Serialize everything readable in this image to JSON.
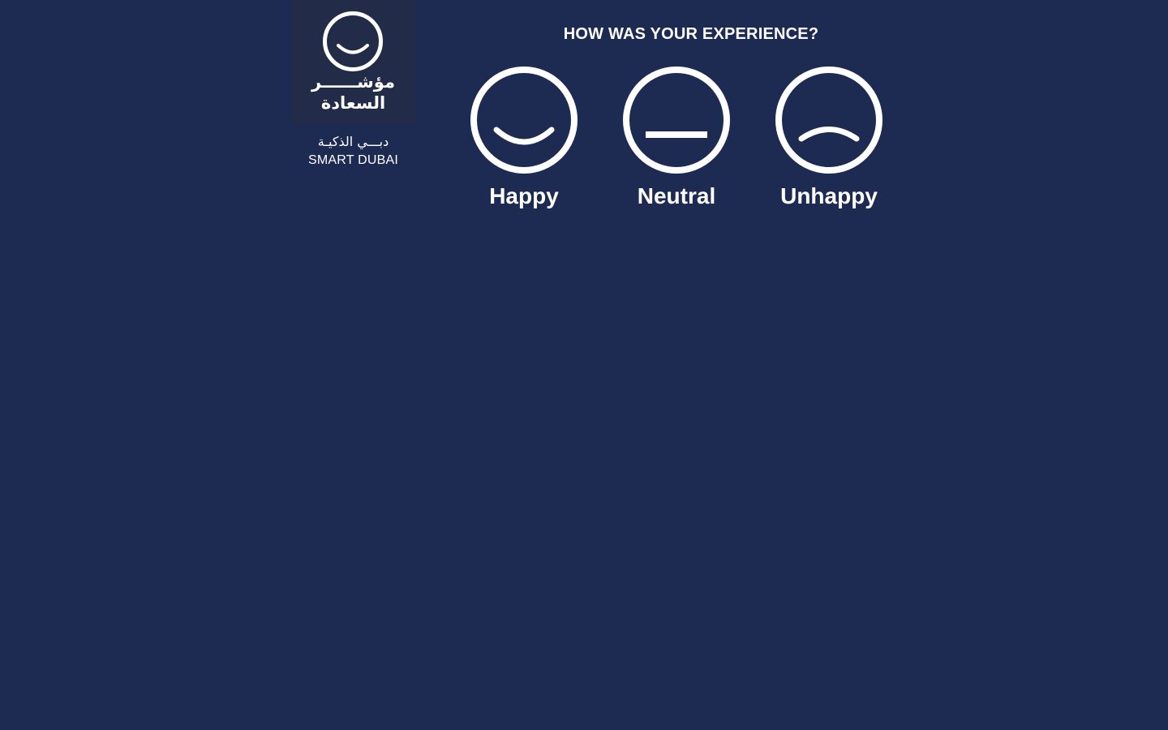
{
  "logo": {
    "arabic_line1": "مؤشــــــر",
    "arabic_line2": "السعادة",
    "icon": "smiley-face-icon"
  },
  "brand": {
    "arabic": "دبـــي الذكيـة",
    "english": "SMART DUBAI"
  },
  "survey": {
    "question": "HOW WAS YOUR EXPERIENCE?",
    "options": [
      {
        "label": "Happy",
        "icon": "happy-face-icon"
      },
      {
        "label": "Neutral",
        "icon": "neutral-face-icon"
      },
      {
        "label": "Unhappy",
        "icon": "unhappy-face-icon"
      }
    ]
  },
  "colors": {
    "background": "#1d2b53",
    "logo_box": "#222b48",
    "foreground": "#ffffff"
  }
}
